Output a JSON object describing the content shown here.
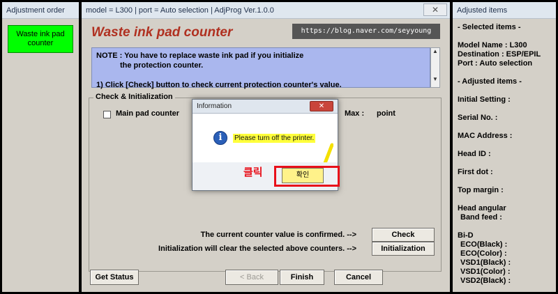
{
  "left_panel": {
    "title": "Adjustment order",
    "items": [
      "Waste ink pad counter"
    ]
  },
  "main_window": {
    "title": "model = L300 | port = Auto selection | AdjProg Ver.1.0.0",
    "close_label": "✕",
    "heading": "Waste ink pad counter",
    "url_watermark": "https://blog.naver.com/seyyoung",
    "note": {
      "line1": "NOTE : You have to replace waste ink pad if you initialize",
      "line2": "the protection counter.",
      "line3": "1) Click [Check] button to check current protection counter's value."
    },
    "group_title": "Check & Initialization",
    "main_pad_label": "Main pad counter",
    "max_label": "Max :",
    "point_label": "point",
    "confirm_text": "The current counter value is confirmed. -->",
    "init_text": "Initialization will clear the selected above counters. -->",
    "check_button": "Check",
    "init_button": "Initialization",
    "get_status_button": "Get Status",
    "back_button": "< Back",
    "finish_button": "Finish",
    "cancel_button": "Cancel"
  },
  "right_panel": {
    "title": "Adjusted items",
    "selected_heading": "- Selected items -",
    "model": "Model Name : L300",
    "destination": "Destination : ESP/EPIL",
    "port": "Port : Auto selection",
    "adjusted_heading": "- Adjusted items -",
    "initial_setting": "Initial Setting :",
    "serial_no": "Serial No. :",
    "mac_address": "MAC Address :",
    "head_id": "Head ID :",
    "first_dot": "First dot :",
    "top_margin": "Top margin :",
    "head_angular": "Head angular",
    "band_feed": "Band feed :",
    "bid": "Bi-D",
    "eco_black": "ECO(Black)  :",
    "eco_color": "ECO(Color)  :",
    "vsd1_black": "VSD1(Black) :",
    "vsd1_color": "VSD1(Color) :",
    "vsd2_black": "VSD2(Black) :"
  },
  "dialog": {
    "title": "Information",
    "close_label": "✕",
    "message": "Please turn off the printer.",
    "ok_button": "확인",
    "annotation": "클릭"
  },
  "colors": {
    "heading": "#b03020",
    "note_bg": "#aab7ee",
    "order_item_bg": "#00ff00",
    "highlight": "#ffff3c",
    "annotation_red": "#e8101a"
  }
}
